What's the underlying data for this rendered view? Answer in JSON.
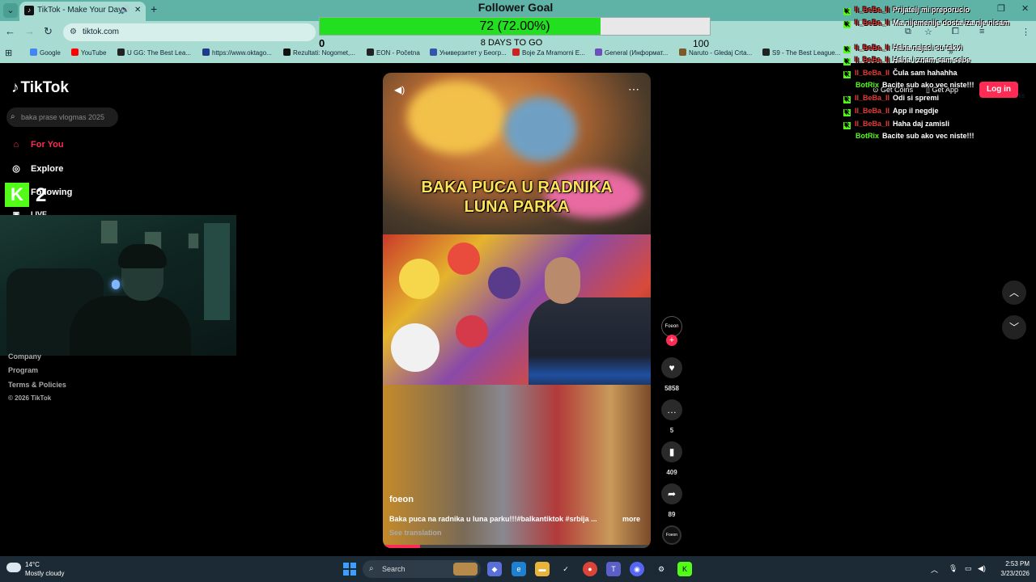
{
  "browser": {
    "tab_title": "TikTok - Make Your Day",
    "url": "tiktok.com",
    "bookmarks": [
      {
        "label": "Google",
        "color": "#4285f4"
      },
      {
        "label": "YouTube",
        "color": "#ff0000"
      },
      {
        "label": "U GG: The Best Lea...",
        "color": "#222222"
      },
      {
        "label": "https://www.oktago...",
        "color": "#1e3a8a"
      },
      {
        "label": "Rezultati: Nogomet,...",
        "color": "#111111"
      },
      {
        "label": "EON - Početna",
        "color": "#222222"
      },
      {
        "label": "Универзитет у Беогр...",
        "color": "#3355aa"
      },
      {
        "label": "Boje Za Mramorni E...",
        "color": "#cc2222"
      },
      {
        "label": "General (Информат...",
        "color": "#6b4fbb"
      },
      {
        "label": "Naruto - Gledaj Crta...",
        "color": "#7a5a2a"
      },
      {
        "label": "S9 - The Best League...",
        "color": "#222222"
      }
    ],
    "all_bookmarks": "All Bookmarks",
    "profile_initial": "D"
  },
  "goal": {
    "title": "Follower Goal",
    "value_text": "72 (72.00%)",
    "progress": 0.72,
    "min": "0",
    "max": "100",
    "days": "8 DAYS TO GO"
  },
  "tiktok": {
    "logo": "TikTok",
    "search_placeholder": "baka prase vlogmas 2025",
    "nav": [
      {
        "label": "For You"
      },
      {
        "label": "Explore"
      },
      {
        "label": "Following"
      },
      {
        "label": "LIVE"
      }
    ],
    "footer": [
      "Company",
      "Program",
      "Terms & Policies",
      "© 2026 TikTok"
    ],
    "get_coins": "Get Coins",
    "get_app": "Get App",
    "login": "Log in"
  },
  "overlay": {
    "kick_number": "2"
  },
  "video": {
    "caption_line1": "BAKA PUCA U RADNIKA",
    "caption_line2": "LUNA PARKA",
    "author": "foeon",
    "description": "Baka puca na radnika u luna parku!!!#balkantiktok #srbija ...",
    "more": "more",
    "see_translation": "See translation",
    "avatar_text": "Foeon",
    "likes": "5858",
    "comments": "5",
    "saves": "409",
    "shares": "89",
    "playback_progress": 0.14
  },
  "chat": [
    {
      "user": "II_BeBa_II",
      "msg": "Prijatelj mi preporucio",
      "type": "user"
    },
    {
      "user": "II_BeBa_II",
      "msg": "Ma nijemenije dosta iza nje nisam",
      "type": "user"
    },
    {
      "user": "II_BeBa_II",
      "msg": "Haha najaci su takvi",
      "type": "user"
    },
    {
      "user": "II_BeBa_II",
      "msg": "Haha i znam sam sebe",
      "type": "user"
    },
    {
      "user": "II_BeBa_II",
      "msg": "Čula sam hahahha",
      "type": "user"
    },
    {
      "user": "BotRix",
      "msg": "Bacite sub ako vec niste!!!",
      "type": "bot"
    },
    {
      "user": "II_BeBa_II",
      "msg": "Odi si spremi",
      "type": "user"
    },
    {
      "user": "II_BeBa_II",
      "msg": "App il negdje",
      "type": "user"
    },
    {
      "user": "II_BeBa_II",
      "msg": "Haha daj zamisli",
      "type": "user"
    },
    {
      "user": "BotRix",
      "msg": "Bacite sub ako vec niste!!!",
      "type": "bot"
    }
  ],
  "taskbar": {
    "temp": "14°C",
    "weather": "Mostly cloudy",
    "search": "Search",
    "time": "2:53 PM",
    "date": "3/23/2026"
  }
}
